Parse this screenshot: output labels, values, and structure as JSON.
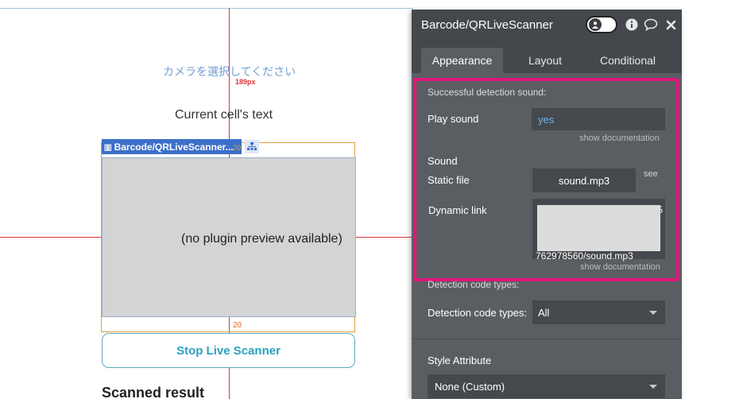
{
  "canvas": {
    "camera_prompt": "カメラを選択してください",
    "spacing_label": "189px",
    "cell_text": "Current cell's text",
    "element_tag": "Barcode/QRLiveScanner...",
    "element_tag_code": "[|||]",
    "tag_number": "20",
    "preview_text": "(no plugin preview available)",
    "bottom_gap": "20",
    "stop_button": "Stop Live Scanner",
    "scanned_heading": "Scanned result"
  },
  "panel": {
    "title": "Barcode/QRLiveScanner",
    "tabs": [
      {
        "label": "Appearance",
        "active": true
      },
      {
        "label": "Layout",
        "active": false
      },
      {
        "label": "Conditional",
        "active": false
      }
    ],
    "detection_sound_heading": "Successful detection sound:",
    "play_sound_label": "Play sound",
    "play_sound_value": "yes",
    "show_doc_1": "show documentation",
    "sound_heading": "Sound",
    "static_file_label": "Static file",
    "static_file_value": "sound.mp3",
    "see_label": "see",
    "dynamic_link_label": "Dynamic link",
    "dynamic_link_partial_right": "5",
    "dynamic_link_partial_bottom": "762978560/sound.mp3",
    "show_doc_2": "show documentation",
    "detection_types_heading": "Detection code types:",
    "detection_types_label": "Detection code types:",
    "detection_types_value": "All",
    "style_heading": "Style Attribute",
    "style_value": "None (Custom)"
  },
  "colors": {
    "highlight": "#e0157a",
    "panel_bg": "#5a5e63",
    "accent_blue": "#3d6fc9",
    "button_text": "#2aa2c0"
  }
}
